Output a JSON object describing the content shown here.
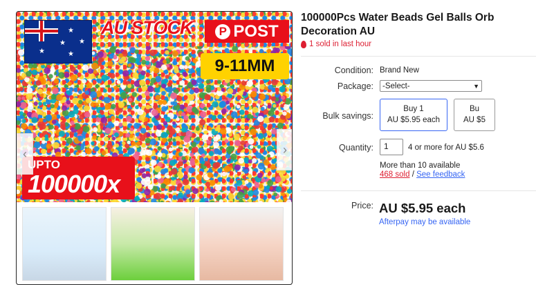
{
  "images": {
    "au_stock": "AU STOCK",
    "post": "POST",
    "post_icon": "P",
    "size": "9-11MM",
    "upto_small": "UPTO",
    "upto_big": "100000x",
    "nav_left": "‹",
    "nav_right": "›"
  },
  "product": {
    "title_line1": "100000Pcs Water Beads Gel Balls Orb",
    "title_line2": "Decoration AU",
    "sold_recent": "1 sold in last hour"
  },
  "details": {
    "condition_label": "Condition:",
    "condition_value": "Brand New",
    "package_label": "Package:",
    "package_selected": "-Select-",
    "bulk_label": "Bulk savings:",
    "bulk_options": [
      {
        "qty": "Buy 1",
        "price": "AU $5.95 each"
      },
      {
        "qty": "Bu",
        "price": "AU $5"
      }
    ],
    "quantity_label": "Quantity:",
    "quantity_value": "1",
    "quantity_note": "4 or more for AU $5.6",
    "available": "More than 10 available",
    "sold_count": "468 sold",
    "separator": "/",
    "feedback_link": "See feedback",
    "price_label": "Price:",
    "price_value": "AU $5.95 each",
    "afterpay": "Afterpay may be available"
  },
  "colors": {
    "accent_blue": "#3665f3",
    "alert_red": "#dd1e31",
    "badge_red": "#e8101a",
    "badge_yellow": "#ffd200"
  }
}
